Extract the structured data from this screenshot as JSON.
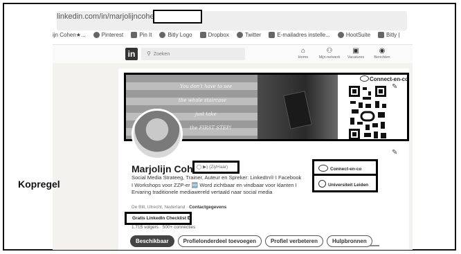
{
  "browser": {
    "url": "linkedin.com/in/marjolijncohen/",
    "bookmarks": [
      {
        "label": "ijn Cohen★...",
        "icon": "profile-icon"
      },
      {
        "label": "Pinterest",
        "icon": "pinterest-icon"
      },
      {
        "label": "Pin It",
        "icon": "pin-icon"
      },
      {
        "label": "Bitly Logo",
        "icon": "bitly-icon"
      },
      {
        "label": "Dropbox",
        "icon": "dropbox-icon"
      },
      {
        "label": "Twitter",
        "icon": "x-icon"
      },
      {
        "label": "E-mailadres instelle...",
        "icon": "mail-icon"
      },
      {
        "label": "HootSuite",
        "icon": "hootsuite-icon"
      },
      {
        "label": "Bitly |",
        "icon": "bitly-icon"
      }
    ]
  },
  "linkedin_nav": {
    "logo": "in",
    "search_placeholder": "Zoeken",
    "items": [
      {
        "label": "Home",
        "icon": "home-icon"
      },
      {
        "label": "Mijn netwerk",
        "icon": "network-icon"
      },
      {
        "label": "Vacatures",
        "icon": "briefcase-icon"
      },
      {
        "label": "Berichten",
        "icon": "message-icon"
      }
    ]
  },
  "banner": {
    "quote_lines": [
      "You don't have to see",
      "the whole staircase",
      "just take",
      "the FIRST STEP!"
    ],
    "brand": "Connect-en-co"
  },
  "profile": {
    "name": "Marjolijn Cohen",
    "pronouns": "(Zij/Haar)",
    "headline": "Social Media Strateeg, Trainer, Auteur en Spreker: LinkedIn® I Facebook I Workshops voor ZZP-er 🆕 Word zichtbaar en vindbaar voor klanten I Ervaring traditionele mediawereld vertaald naar social media",
    "location": "De Bilt, Utrecht, Nederland · ",
    "contact_label": "Contactgegevens",
    "featured_link": "Gratis LinkedIn Checklist ⧉",
    "followers": "1.715 volgers · 500+ connecties",
    "organizations": [
      {
        "label": "Connect-en-co",
        "icon": "connect-en-co-logo-icon"
      },
      {
        "label": "Universiteit Leiden",
        "icon": "university-seal-icon"
      }
    ]
  },
  "buttons": {
    "available": "Beschikbaar",
    "add_section": "Profielonderdeel toevoegen",
    "improve": "Profiel verbeteren",
    "resources": "Hulpbronnen"
  },
  "annotation": {
    "label": "Kopregel"
  }
}
